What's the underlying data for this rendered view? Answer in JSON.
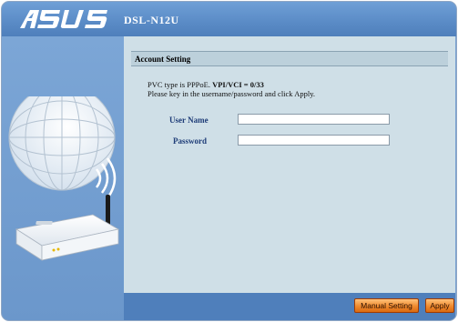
{
  "header": {
    "brand": "ASUS",
    "model": "DSL-N12U"
  },
  "content": {
    "section_title": "Account Setting",
    "info_prefix": "PVC type is PPPoE. ",
    "info_vpi": "VPI/VCI = 0/33",
    "info_line2": "Please key in the username/password and click Apply.",
    "username_label": "User Name",
    "username_value": "",
    "password_label": "Password",
    "password_value": ""
  },
  "footer": {
    "manual_setting_label": "Manual Setting",
    "apply_label": "Apply"
  },
  "colors": {
    "header_blue": "#5a8bc6",
    "content_bg": "#cfdfe7",
    "label_blue": "#1f3d78",
    "button_orange": "#f08a2e"
  }
}
